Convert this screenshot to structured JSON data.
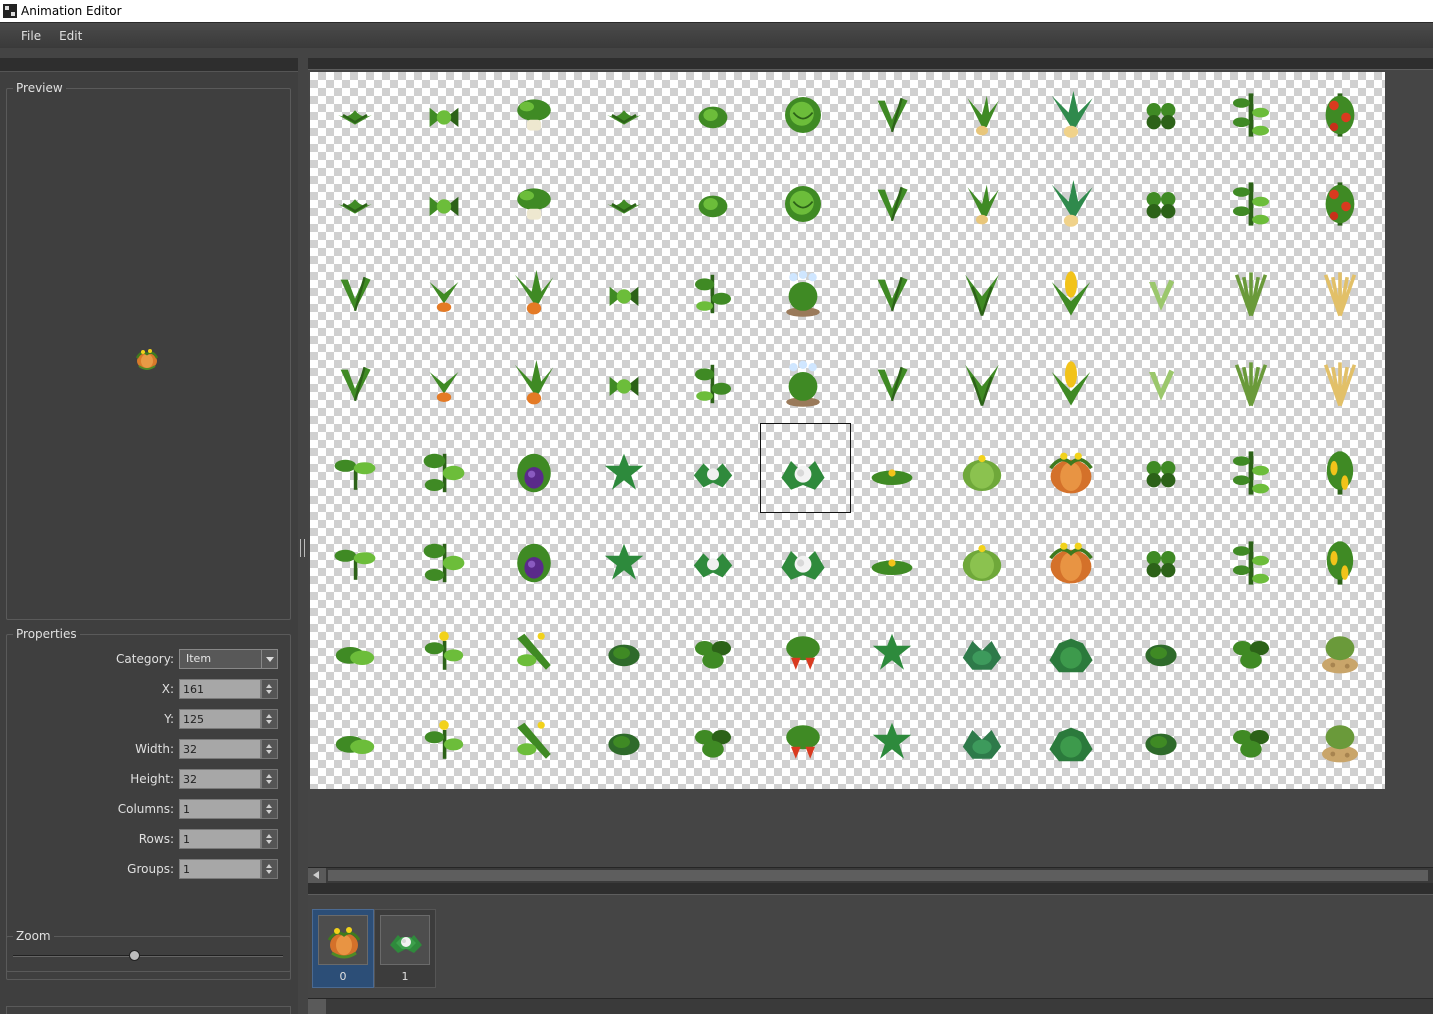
{
  "window": {
    "title": "Animation Editor"
  },
  "menu": {
    "file": "File",
    "edit": "Edit"
  },
  "preview": {
    "title": "Preview"
  },
  "properties": {
    "title": "Properties",
    "category_label": "Category:",
    "category_value": "Item",
    "x_label": "X:",
    "x_value": "161",
    "y_label": "Y:",
    "y_value": "125",
    "width_label": "Width:",
    "width_value": "32",
    "height_label": "Height:",
    "height_value": "32",
    "columns_label": "Columns:",
    "columns_value": "1",
    "rows_label": "Rows:",
    "rows_value": "1",
    "groups_label": "Groups:",
    "groups_value": "1"
  },
  "zoom": {
    "title": "Zoom",
    "level": 0.45
  },
  "frames": {
    "items": [
      {
        "label": "0",
        "icon": "pumpkin-sprite-icon"
      },
      {
        "label": "1",
        "icon": "cauliflower-sprite-icon"
      }
    ],
    "selected_index": 0
  },
  "sprite_sheet": {
    "columns": 12,
    "rows": 8,
    "row_sprites": [
      [
        "sprout",
        "leafy",
        "potplant",
        "sprout",
        "cabbage-small",
        "cabbage",
        "v-sprout",
        "carrot-leaves",
        "carrot-big",
        "clover",
        "vine",
        "tomato"
      ],
      [
        "sprout",
        "leafy",
        "potplant",
        "sprout",
        "cabbage-small",
        "cabbage",
        "v-sprout",
        "carrot-leaves",
        "carrot-big",
        "clover",
        "vine",
        "tomato"
      ],
      [
        "v-sprout",
        "carrot-small",
        "carrot-mid",
        "leafy",
        "vine-leaves",
        "flowering-bush",
        "v-sprout",
        "corn-leaves",
        "corn",
        "v-sprout-pale",
        "wheat-green",
        "wheat"
      ],
      [
        "v-sprout",
        "carrot-small",
        "carrot-mid",
        "leafy",
        "vine-leaves",
        "flowering-bush",
        "v-sprout",
        "corn-leaves",
        "corn",
        "v-sprout-pale",
        "wheat-green",
        "wheat"
      ],
      [
        "seedling",
        "bean-plant",
        "eggplant",
        "star-leaf",
        "cauliflower-small",
        "cauliflower",
        "flat-flower",
        "melon",
        "pumpkin",
        "clover",
        "vine",
        "pepper"
      ],
      [
        "seedling",
        "bean-plant",
        "eggplant",
        "star-leaf",
        "cauliflower-small",
        "cauliflower",
        "flat-flower",
        "melon",
        "pumpkin",
        "clover",
        "vine",
        "pepper"
      ],
      [
        "leaf-pile",
        "flower-plant",
        "cucumber",
        "bush-small",
        "bush-leaves",
        "strawberry",
        "star-leaf",
        "lettuce",
        "cabbage-dark",
        "bush-small",
        "bush-leaves",
        "potato"
      ],
      [
        "leaf-pile",
        "flower-plant",
        "cucumber",
        "bush-small",
        "bush-leaves",
        "strawberry",
        "star-leaf",
        "lettuce",
        "cabbage-dark",
        "bush-small",
        "bush-leaves",
        "potato"
      ]
    ]
  },
  "colors": {
    "accent": "#2c4e77",
    "panel": "#3f3f3f",
    "background": "#444444"
  }
}
